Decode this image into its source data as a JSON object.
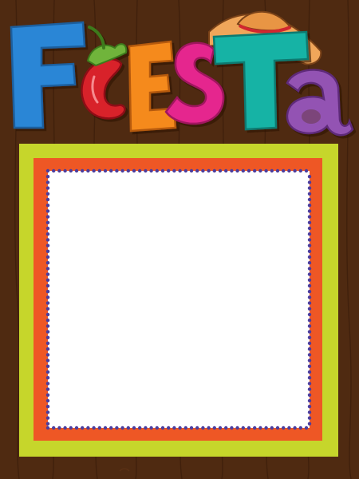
{
  "title": {
    "letters": [
      "F",
      "i",
      "E",
      "S",
      "T",
      "a"
    ],
    "colors": [
      "#2B86D6",
      "#D8202A",
      "#F58A1F",
      "#E5288E",
      "#19B3A5",
      "#9353B3"
    ]
  },
  "colors": {
    "wood": "#4F2A11",
    "frame_outer": "#C6D62B",
    "frame_mid": "#EE5725",
    "inner_panel": "#FFFFFF",
    "dot_border": "#4B3D9E",
    "pepper_stem": "#6FB43A",
    "sombrero": "#F0A65A"
  },
  "icons": [
    "chili-pepper-icon",
    "sombrero-icon"
  ]
}
